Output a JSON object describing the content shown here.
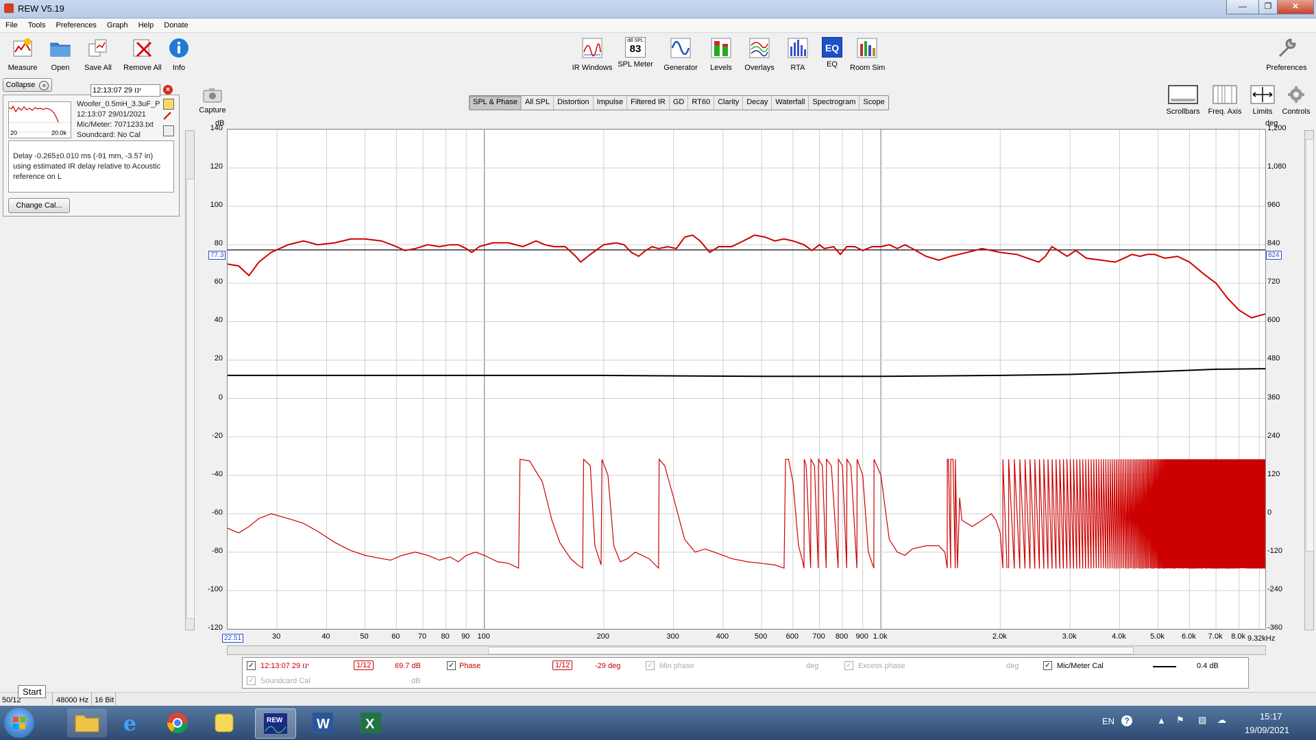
{
  "window": {
    "title": "REW V5.19"
  },
  "menu": [
    "File",
    "Tools",
    "Preferences",
    "Graph",
    "Help",
    "Donate"
  ],
  "toolbar_left": [
    {
      "label": "Measure",
      "icon": "measure-icon"
    },
    {
      "label": "Open",
      "icon": "folder-icon"
    },
    {
      "label": "Save All",
      "icon": "save-icon"
    },
    {
      "label": "Remove All",
      "icon": "remove-icon"
    },
    {
      "label": "Info",
      "icon": "info-icon"
    }
  ],
  "toolbar_center": [
    {
      "label": "IR Windows",
      "icon": "ir-windows-icon"
    },
    {
      "label": "SPL Meter",
      "icon": "spl-meter-icon",
      "badge_top": "dB SPL",
      "badge_value": "83"
    },
    {
      "label": "Generator",
      "icon": "generator-icon"
    },
    {
      "label": "Levels",
      "icon": "levels-icon"
    },
    {
      "label": "Overlays",
      "icon": "overlays-icon"
    },
    {
      "label": "RTA",
      "icon": "rta-icon"
    },
    {
      "label": "EQ",
      "icon": "eq-icon"
    },
    {
      "label": "Room Sim",
      "icon": "room-sim-icon"
    }
  ],
  "toolbar_right": {
    "label": "Preferences",
    "icon": "wrench-icon"
  },
  "graph_tools": [
    {
      "label": "Scrollbars",
      "icon": "scrollbars-icon"
    },
    {
      "label": "Freq. Axis",
      "icon": "freq-axis-icon"
    },
    {
      "label": "Limits",
      "icon": "limits-icon"
    },
    {
      "label": "Controls",
      "icon": "controls-icon"
    }
  ],
  "capture": {
    "label": "Capture"
  },
  "panel": {
    "collapse_label": "Collapse",
    "measurement_name": "12:13:07 29 ינו",
    "details": [
      "Woofer_0.5mH_3.3uF_P",
      "12:13:07 29/01/2021",
      "Mic/Meter: 7071233.txt",
      "Soundcard: No Cal"
    ],
    "thumb_left": "20",
    "thumb_right": "20.0k",
    "note": "Delay -0.265±0.010 ms (-91 mm, -3.57 in) using estimated IR delay relative to Acoustic reference on  L",
    "change_cal_label": "Change Cal..."
  },
  "tabs": [
    {
      "label": "SPL & Phase",
      "selected": true
    },
    {
      "label": "All SPL"
    },
    {
      "label": "Distortion"
    },
    {
      "label": "Impulse"
    },
    {
      "label": "Filtered IR"
    },
    {
      "label": "GD"
    },
    {
      "label": "RT60"
    },
    {
      "label": "Clarity"
    },
    {
      "label": "Decay"
    },
    {
      "label": "Waterfall"
    },
    {
      "label": "Spectrogram"
    },
    {
      "label": "Scope"
    }
  ],
  "axes": {
    "left_unit": "dB",
    "right_unit": "deg",
    "left_ticks": [
      "140",
      "120",
      "100",
      "80",
      "60",
      "40",
      "20",
      "0",
      "-20",
      "-40",
      "-60",
      "-80",
      "-100",
      "-120"
    ],
    "right_ticks": [
      "1,200",
      "1,080",
      "960",
      "840",
      "720",
      "600",
      "480",
      "360",
      "240",
      "120",
      "0",
      "-120",
      "-240",
      "-360"
    ],
    "x_ticks": [
      {
        "f": 30,
        "t": "30"
      },
      {
        "f": 40,
        "t": "40"
      },
      {
        "f": 50,
        "t": "50"
      },
      {
        "f": 60,
        "t": "60"
      },
      {
        "f": 70,
        "t": "70"
      },
      {
        "f": 80,
        "t": "80"
      },
      {
        "f": 90,
        "t": "90"
      },
      {
        "f": 100,
        "t": "100"
      },
      {
        "f": 200,
        "t": "200"
      },
      {
        "f": 300,
        "t": "300"
      },
      {
        "f": 400,
        "t": "400"
      },
      {
        "f": 500,
        "t": "500"
      },
      {
        "f": 600,
        "t": "600"
      },
      {
        "f": 700,
        "t": "700"
      },
      {
        "f": 800,
        "t": "800"
      },
      {
        "f": 900,
        "t": "900"
      },
      {
        "f": 1000,
        "t": "1.0k"
      },
      {
        "f": 2000,
        "t": "2.0k"
      },
      {
        "f": 3000,
        "t": "3.0k"
      },
      {
        "f": 4000,
        "t": "4.0k"
      },
      {
        "f": 5000,
        "t": "5.0k"
      },
      {
        "f": 6000,
        "t": "6.0k"
      },
      {
        "f": 7000,
        "t": "7.0k"
      },
      {
        "f": 8000,
        "t": "8.0k"
      }
    ],
    "x_start_label": "22.51",
    "x_end_label": "9.32kHz",
    "cursor_left": "77.3",
    "cursor_right": "824"
  },
  "chart_data": {
    "type": "line",
    "xlim": [
      22.51,
      9320
    ],
    "x_scale": "log",
    "ylim": [
      -120,
      140
    ],
    "y2lim": [
      -360,
      1200
    ],
    "grid": true,
    "legend": "bottom",
    "series": [
      {
        "name": "12:13:07 29 ינו",
        "axis": "dB",
        "color": "#cc0000",
        "points": [
          [
            22.5,
            70
          ],
          [
            24,
            69
          ],
          [
            25.5,
            64
          ],
          [
            27,
            71
          ],
          [
            29,
            76
          ],
          [
            32,
            80
          ],
          [
            35,
            82
          ],
          [
            38,
            80
          ],
          [
            42,
            81
          ],
          [
            46,
            83
          ],
          [
            50,
            83
          ],
          [
            55,
            82
          ],
          [
            60,
            79
          ],
          [
            63,
            77
          ],
          [
            67,
            78
          ],
          [
            72,
            80
          ],
          [
            77,
            79
          ],
          [
            82,
            80
          ],
          [
            86,
            80
          ],
          [
            90,
            78
          ],
          [
            93,
            76
          ],
          [
            97,
            79
          ],
          [
            105,
            81
          ],
          [
            115,
            81
          ],
          [
            125,
            79
          ],
          [
            135,
            82
          ],
          [
            142,
            80
          ],
          [
            150,
            79
          ],
          [
            160,
            79
          ],
          [
            170,
            74
          ],
          [
            175,
            71
          ],
          [
            185,
            75
          ],
          [
            200,
            80
          ],
          [
            215,
            81
          ],
          [
            225,
            80
          ],
          [
            235,
            76
          ],
          [
            245,
            74
          ],
          [
            255,
            77
          ],
          [
            265,
            79
          ],
          [
            275,
            78
          ],
          [
            290,
            79
          ],
          [
            305,
            78
          ],
          [
            320,
            84
          ],
          [
            335,
            85
          ],
          [
            350,
            82
          ],
          [
            370,
            76
          ],
          [
            390,
            79
          ],
          [
            420,
            79
          ],
          [
            450,
            82
          ],
          [
            480,
            85
          ],
          [
            510,
            84
          ],
          [
            540,
            82
          ],
          [
            570,
            83
          ],
          [
            600,
            82
          ],
          [
            640,
            80
          ],
          [
            670,
            77
          ],
          [
            700,
            80
          ],
          [
            720,
            78
          ],
          [
            760,
            79
          ],
          [
            790,
            75
          ],
          [
            820,
            79
          ],
          [
            860,
            79
          ],
          [
            900,
            77
          ],
          [
            950,
            79
          ],
          [
            1000,
            79
          ],
          [
            1050,
            80
          ],
          [
            1100,
            78
          ],
          [
            1150,
            80
          ],
          [
            1200,
            78
          ],
          [
            1300,
            74
          ],
          [
            1400,
            72
          ],
          [
            1500,
            74
          ],
          [
            1650,
            76
          ],
          [
            1800,
            78
          ],
          [
            2000,
            76
          ],
          [
            2200,
            75
          ],
          [
            2500,
            71
          ],
          [
            2600,
            74
          ],
          [
            2700,
            79
          ],
          [
            2800,
            77
          ],
          [
            2950,
            74
          ],
          [
            3100,
            77
          ],
          [
            3300,
            73
          ],
          [
            3600,
            72
          ],
          [
            3900,
            71
          ],
          [
            4100,
            73
          ],
          [
            4300,
            75
          ],
          [
            4500,
            74
          ],
          [
            4700,
            75
          ],
          [
            4900,
            75
          ],
          [
            5200,
            73
          ],
          [
            5600,
            74
          ],
          [
            6000,
            71
          ],
          [
            6500,
            65
          ],
          [
            7000,
            60
          ],
          [
            7500,
            52
          ],
          [
            8000,
            46
          ],
          [
            8600,
            42
          ],
          [
            9320,
            44
          ]
        ]
      },
      {
        "name": "Mic/Meter Cal",
        "axis": "dB",
        "color": "#000000",
        "points": [
          [
            22.5,
            12
          ],
          [
            50,
            12
          ],
          [
            100,
            12
          ],
          [
            200,
            12
          ],
          [
            500,
            11.5
          ],
          [
            1000,
            11.5
          ],
          [
            2000,
            12
          ],
          [
            3000,
            12.5
          ],
          [
            5000,
            14
          ],
          [
            7000,
            15.2
          ],
          [
            9320,
            15.5
          ]
        ]
      },
      {
        "name": "Phase",
        "axis": "deg",
        "color": "#cc0000",
        "points": [
          [
            22.5,
            -45
          ],
          [
            24,
            -60
          ],
          [
            25.5,
            -40
          ],
          [
            27,
            -15
          ],
          [
            29,
            0
          ],
          [
            32,
            -15
          ],
          [
            35,
            -30
          ],
          [
            38,
            -55
          ],
          [
            42,
            -90
          ],
          [
            46,
            -115
          ],
          [
            50,
            -130
          ],
          [
            55,
            -140
          ],
          [
            58,
            -145
          ],
          [
            62,
            -130
          ],
          [
            67,
            -120
          ],
          [
            72,
            -130
          ],
          [
            77,
            -145
          ],
          [
            82,
            -135
          ],
          [
            86,
            -150
          ],
          [
            90,
            -130
          ],
          [
            95,
            -120
          ],
          [
            100,
            -130
          ],
          [
            108,
            -150
          ],
          [
            115,
            -155
          ],
          [
            122,
            -170
          ],
          [
            123,
            170
          ],
          [
            130,
            165
          ],
          [
            140,
            100
          ],
          [
            148,
            -20
          ],
          [
            155,
            -90
          ],
          [
            165,
            -140
          ],
          [
            172,
            -160
          ],
          [
            177,
            -170
          ],
          [
            178,
            170
          ],
          [
            185,
            150
          ],
          [
            190,
            -100
          ],
          [
            197,
            -160
          ],
          [
            198,
            170
          ],
          [
            205,
            120
          ],
          [
            212,
            -100
          ],
          [
            220,
            -150
          ],
          [
            230,
            -140
          ],
          [
            240,
            -120
          ],
          [
            260,
            -140
          ],
          [
            270,
            -160
          ],
          [
            275,
            -170
          ],
          [
            276,
            170
          ],
          [
            285,
            150
          ],
          [
            300,
            50
          ],
          [
            320,
            -80
          ],
          [
            340,
            -120
          ],
          [
            360,
            -110
          ],
          [
            380,
            -120
          ],
          [
            420,
            -140
          ],
          [
            460,
            -150
          ],
          [
            500,
            -155
          ],
          [
            540,
            -160
          ],
          [
            570,
            -170
          ],
          [
            575,
            170
          ],
          [
            585,
            170
          ],
          [
            600,
            100
          ],
          [
            620,
            -100
          ],
          [
            635,
            -150
          ],
          [
            640,
            -170
          ],
          [
            641,
            170
          ],
          [
            648,
            150
          ],
          [
            665,
            -170
          ],
          [
            666,
            170
          ],
          [
            680,
            150
          ],
          [
            695,
            -170
          ],
          [
            696,
            170
          ],
          [
            712,
            150
          ],
          [
            728,
            -170
          ],
          [
            729,
            170
          ],
          [
            750,
            150
          ],
          [
            780,
            -170
          ],
          [
            781,
            170
          ],
          [
            800,
            150
          ],
          [
            820,
            -170
          ],
          [
            821,
            170
          ],
          [
            840,
            150
          ],
          [
            870,
            -170
          ],
          [
            871,
            170
          ],
          [
            900,
            120
          ],
          [
            930,
            -120
          ],
          [
            960,
            -170
          ],
          [
            961,
            170
          ],
          [
            1000,
            120
          ],
          [
            1050,
            -80
          ],
          [
            1100,
            -120
          ],
          [
            1150,
            -130
          ],
          [
            1200,
            -110
          ],
          [
            1300,
            -100
          ],
          [
            1400,
            -100
          ],
          [
            1450,
            -120
          ],
          [
            1470,
            -170
          ],
          [
            1471,
            170
          ],
          [
            1480,
            170
          ],
          [
            1500,
            -170
          ],
          [
            1501,
            170
          ],
          [
            1520,
            170
          ],
          [
            1540,
            -170
          ],
          [
            1541,
            170
          ],
          [
            1560,
            -170
          ],
          [
            1580,
            50
          ],
          [
            1600,
            -20
          ],
          [
            1700,
            -40
          ],
          [
            1800,
            -20
          ],
          [
            1900,
            0
          ],
          [
            1950,
            -20
          ],
          [
            2000,
            -60
          ],
          [
            2030,
            -170
          ],
          [
            2031,
            170
          ],
          [
            2080,
            -170
          ]
        ]
      },
      {
        "name": "Phase (dense wrap)",
        "axis": "deg",
        "color": "#cc0000",
        "wrap_from": 2100,
        "wrap_to": 9320,
        "wrap_min": -170,
        "wrap_max": 170
      }
    ]
  },
  "legend": {
    "rows": [
      {
        "checked": true,
        "name": "12:13:07 29 ינו",
        "smoothing": "1/12",
        "value": "69.7 dB",
        "phase_label": "Phase",
        "phase_smoothing": "1/12",
        "phase_value": "-29 deg",
        "minphase_label": "Min phase",
        "minphase_unit": "deg",
        "excess_label": "Excess phase",
        "excess_unit": "deg",
        "mic_label": "Mic/Meter Cal",
        "mic_value": "0.4 dB"
      },
      {
        "soundcard_label": "Soundcard Cal",
        "soundcard_unit": "dB"
      }
    ]
  },
  "status": {
    "start_tooltip": "Start",
    "mem": "50/12",
    "rate": "48000 Hz",
    "bits": "16 Bit"
  },
  "tray": {
    "lang": "EN",
    "time": "15:17",
    "date": "19/09/2021"
  }
}
